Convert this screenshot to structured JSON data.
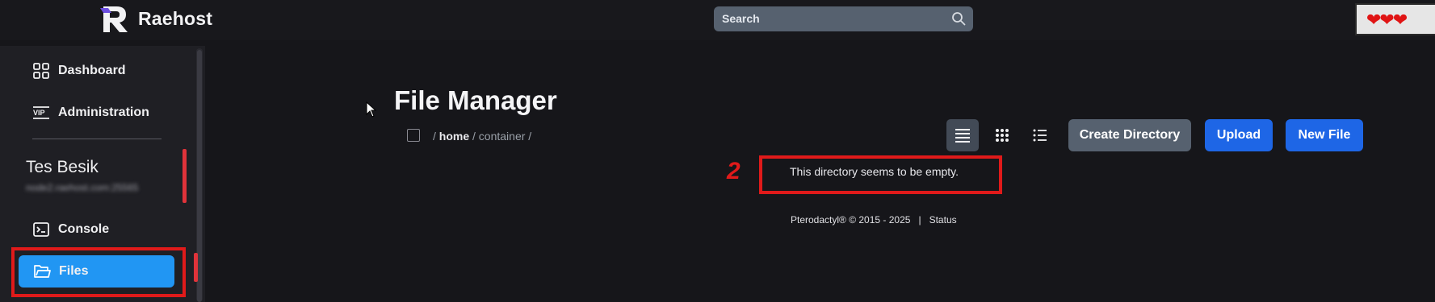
{
  "header": {
    "brand": "Raehost",
    "search_placeholder": "Search",
    "hearts": "❤❤❤"
  },
  "sidebar": {
    "items": [
      {
        "label": "Dashboard",
        "icon": "grid-icon"
      },
      {
        "label": "Administration",
        "icon": "vip-icon"
      }
    ],
    "server": {
      "name": "Tes Besik",
      "address": "node2.raehost.com:25565"
    },
    "console": {
      "label": "Console",
      "icon": "terminal-icon"
    },
    "files": {
      "label": "Files",
      "icon": "folder-icon"
    }
  },
  "main": {
    "title": "File Manager",
    "breadcrumb": {
      "sep1": "/",
      "home": "home",
      "sep2": "/",
      "container": "container",
      "sep3": "/"
    },
    "buttons": {
      "create_directory": "Create Directory",
      "upload": "Upload",
      "new_file": "New File"
    },
    "view_modes": [
      "list-view-icon",
      "grid-view-icon",
      "compact-list-icon"
    ],
    "empty_message": "This directory seems to be empty.",
    "footer": {
      "copyright": "Pterodactyl® © 2015 - 2025",
      "separator": "|",
      "status": "Status"
    }
  },
  "annotations": {
    "marker_number": "2"
  },
  "colors": {
    "accent_blue": "#1e66e6",
    "files_active": "#2196f3",
    "annotation_red": "#e01a1a"
  }
}
